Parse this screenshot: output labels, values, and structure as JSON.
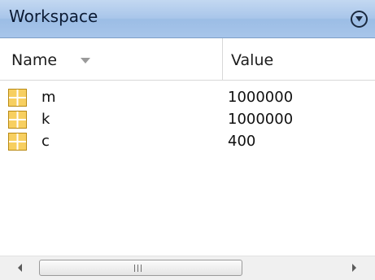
{
  "panel": {
    "title": "Workspace",
    "menu_icon": "circle-chevron-down-icon"
  },
  "columns": {
    "name_label": "Name",
    "name_sort_icon": "sort-descending-triangle-icon",
    "value_label": "Value"
  },
  "variables": [
    {
      "name": "m",
      "value": "1000000",
      "icon": "matrix-grid-icon"
    },
    {
      "name": "k",
      "value": "1000000",
      "icon": "matrix-grid-icon"
    },
    {
      "name": "c",
      "value": "400",
      "icon": "matrix-grid-icon"
    }
  ],
  "scrollbar": {
    "left_icon": "arrow-left-icon",
    "right_icon": "arrow-right-icon",
    "grip_icon": "scroll-grip-icon"
  },
  "colors": {
    "title_bar": "#a9c6ea",
    "variable_icon_fill": "#f7cf60",
    "variable_icon_border": "#b98a14"
  }
}
